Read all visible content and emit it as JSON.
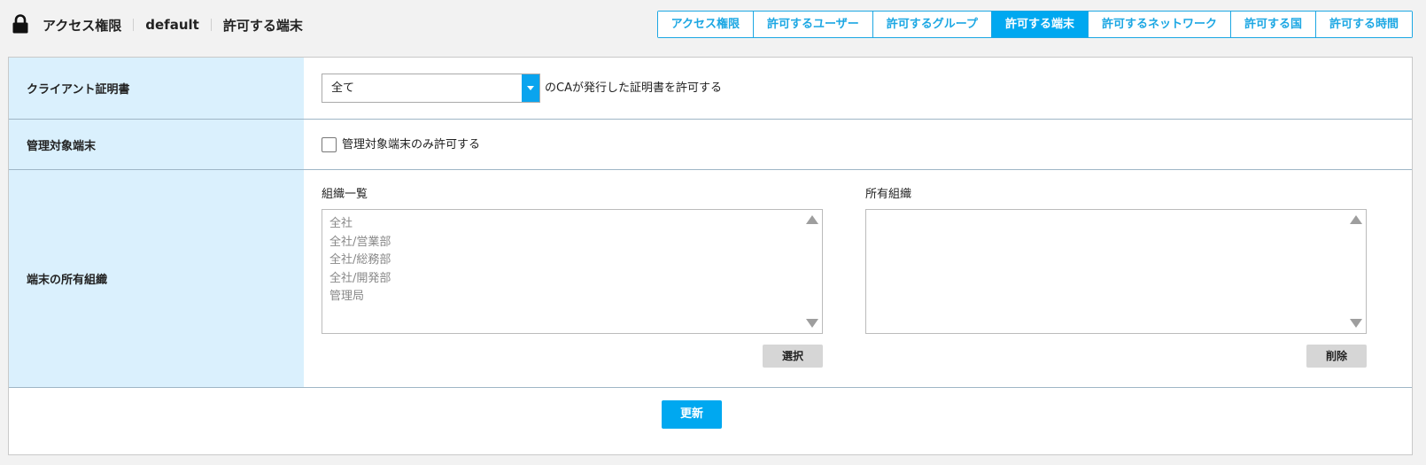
{
  "header": {
    "icon": "lock-icon",
    "breadcrumbs": [
      "アクセス権限",
      "default",
      "許可する端末"
    ]
  },
  "tabs": [
    {
      "label": "アクセス権限",
      "active": false
    },
    {
      "label": "許可するユーザー",
      "active": false
    },
    {
      "label": "許可するグループ",
      "active": false
    },
    {
      "label": "許可する端末",
      "active": true
    },
    {
      "label": "許可するネットワーク",
      "active": false
    },
    {
      "label": "許可する国",
      "active": false
    },
    {
      "label": "許可する時間",
      "active": false
    }
  ],
  "client_cert": {
    "label": "クライアント証明書",
    "selected": "全て",
    "suffix": "のCAが発行した証明書を許可する"
  },
  "managed": {
    "label": "管理対象端末",
    "checked": false,
    "checkbox_label": "管理対象端末のみ許可する"
  },
  "org": {
    "label": "端末の所有組織",
    "available_title": "組織一覧",
    "available": [
      "全社",
      "全社/営業部",
      "全社/総務部",
      "全社/開発部",
      "管理局"
    ],
    "owned_title": "所有組織",
    "owned": [],
    "select_button": "選択",
    "remove_button": "削除"
  },
  "update_button": "更新",
  "colors": {
    "accent": "#00a8f0",
    "label_bg": "#daf0fd"
  }
}
